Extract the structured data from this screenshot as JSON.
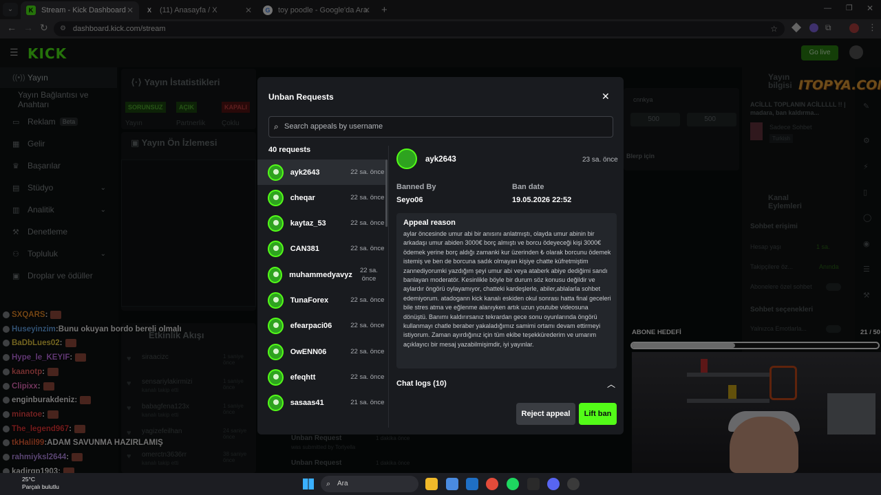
{
  "browser": {
    "tabs": [
      {
        "title": "Stream - Kick Dashboard",
        "icon": "kick-icon"
      },
      {
        "title": "(11) Anasayfa / X",
        "icon": "x-icon"
      },
      {
        "title": "toy poodle - Google'da Ara",
        "icon": "google-icon"
      }
    ],
    "new_tab": "+",
    "url": "dashboard.kick.com/stream"
  },
  "kick": {
    "logo": "KICK",
    "go_live": "Go live",
    "sidebar": [
      {
        "label": "Yayın",
        "icon": "broadcast-icon"
      },
      {
        "label": "Yayın Bağlantısı ve Anahtarı",
        "icon": ""
      },
      {
        "label": "Reklam",
        "icon": "ad-icon",
        "badge": "Beta"
      },
      {
        "label": "Gelir",
        "icon": "revenue-icon"
      },
      {
        "label": "Başarılar",
        "icon": "trophy-icon"
      },
      {
        "label": "Stüdyo",
        "icon": "studio-icon"
      },
      {
        "label": "Analitik",
        "icon": "analytics-icon"
      },
      {
        "label": "Denetleme",
        "icon": "moderation-icon"
      },
      {
        "label": "Topluluk",
        "icon": "community-icon"
      },
      {
        "label": "Droplar ve ödüller",
        "icon": "drops-icon"
      }
    ],
    "stats_title": "Yayın İstatistikleri",
    "stats_badges": [
      "SORUNSUZ",
      "AÇIK",
      "KAPALI"
    ],
    "stats_labels": [
      "Yayın",
      "Partnerlik",
      "Çoklu"
    ],
    "preview_title": "Yayın Ön İzlemesi",
    "activity_title": "Etkinlik Akışı",
    "activity_items": [
      {
        "user": "siraacizc",
        "sub": "kanalı takip etti",
        "time": "1 saniye önce"
      },
      {
        "user": "sensariylakirmizi",
        "sub": "kanalı takip etti",
        "time": "1 saniye önce"
      },
      {
        "user": "babagfena123x",
        "sub": "kanalı takip etti",
        "time": "1 saniye önce"
      },
      {
        "user": "yagizefeilhan",
        "sub": "kanalı takip etti",
        "time": "24 saniye önce"
      },
      {
        "user": "omerctn3636rr",
        "sub": "kanalı takip etti",
        "time": "38 saniye önce"
      }
    ],
    "unban_bottom": [
      {
        "title": "Unban Request",
        "sub": "was submitted by Torlyella",
        "time": "1 dakika önce"
      },
      {
        "title": "Unban Request",
        "sub": "",
        "time": "1 dakika önce"
      }
    ],
    "right_panel": {
      "stream_info_title": "Yayın bilgisi",
      "stream_title_text": "ACİLLL TOPLANIN ACİLLLLL !! | madara, ban kaldırma...",
      "category": "Sadece Sohbet",
      "language": "Turkish",
      "channel_actions_title": "Kanal Eylemleri",
      "chat_access": "Sohbet erişimi",
      "account_age": "Hesap yaşı",
      "account_age_value": "1 sa.",
      "followers_only": "Takipçilere öz...",
      "followers_value": "Anında",
      "subs_only": "Abonelere özel sohbet",
      "chat_options": "Sohbet seçenekleri",
      "emotes_only": "Yalnızca Emotlarla..."
    },
    "middle_right": {
      "user": "cnnkya",
      "pill_values": [
        "500",
        "500"
      ],
      "blerp": "Blerp için"
    }
  },
  "modal": {
    "title": "Unban Requests",
    "search_placeholder": "Search appeals by username",
    "count": "40 requests",
    "requests": [
      {
        "user": "ayk2643",
        "time": "22 sa. önce"
      },
      {
        "user": "cheqar",
        "time": "22 sa. önce"
      },
      {
        "user": "kaytaz_53",
        "time": "22 sa. önce"
      },
      {
        "user": "CAN381",
        "time": "22 sa. önce"
      },
      {
        "user": "muhammedyavyz",
        "time": "22 sa. önce"
      },
      {
        "user": "TunaForex",
        "time": "22 sa. önce"
      },
      {
        "user": "efearpaci06",
        "time": "22 sa. önce"
      },
      {
        "user": "OwENN06",
        "time": "22 sa. önce"
      },
      {
        "user": "efeqhtt",
        "time": "22 sa. önce"
      },
      {
        "user": "sasaas41",
        "time": "21 sa. önce"
      }
    ],
    "detail": {
      "user": "ayk2643",
      "time": "23 sa. önce",
      "banned_by_label": "Banned By",
      "banned_by": "Seyo06",
      "ban_date_label": "Ban date",
      "ban_date": "19.05.2026 22:52",
      "appeal_title": "Appeal reason",
      "appeal_text": "aylar öncesinde umur abi bir anısını anlatmıştı, olayda umur abinin bir arkadaşı umur abiden 3000€ borç almıştı ve borcu ödeyeceği kişi 3000€ ödemek yerine borç aldığı zamanki kur üzerinden ₺ olarak borcunu ödemek istemiş ve ben de borcuna sadık olmayan kişiye chatte küfretmiştim zannediyorumki yazdığım şeyi umur abi veya ataberk abiye dediğimi sandı banlayan moderatör. Kesinlikle böyle bir durum söz konusu değildir ve aylardır öngörü oylayamıyor, chatteki kardeşlerle, abiler,ablalarla sohbet edemiyorum. atadogann kick kanalı eskiden okul sonrası hatta final geceleri bile stres atma ve eğlenme alanıyken artık uzun youtube videosuna dönüştü. Banımı kaldırırsanız tekrardan gece sonu oyunlarında öngörü kullanmayı chatle beraber yakaladığımız samimi ortamı devam ettirmeyi istiyorum. Zaman ayırdığınız için tüm ekibe teşekkürederim ve umarım açıklayıcı bir mesaj yazabilmişimdir, iyi yayınlar.",
      "chat_logs": "Chat logs (10)",
      "reject_label": "Reject appeal",
      "lift_label": "Lift ban"
    }
  },
  "chat_overlay": [
    {
      "user": "SXQARS",
      "color": "#ff9a2e",
      "msg": ""
    },
    {
      "user": "Huseyinzim",
      "color": "#6fb7ff",
      "msg": "Bunu okuyan bordo bereli olmalı"
    },
    {
      "user": "BaDbLues02",
      "color": "#ffe14a",
      "msg": ""
    },
    {
      "user": "Hype_le_KEYIF",
      "color": "#d67cff",
      "msg": ""
    },
    {
      "user": "kaanotp",
      "color": "#ff6b6b",
      "msg": ""
    },
    {
      "user": "Clipixx",
      "color": "#ff7bd0",
      "msg": ""
    },
    {
      "user": "enginburakdeniz",
      "color": "#ffffff",
      "msg": ""
    },
    {
      "user": "minatoe",
      "color": "#ff4d4d",
      "msg": ""
    },
    {
      "user": "The_legend967",
      "color": "#ff3d3d",
      "msg": ""
    },
    {
      "user": "tkHalil99",
      "color": "#ff6a3d",
      "msg": "ADAM SAVUNMA HAZIRLAMIŞ"
    },
    {
      "user": "rahmiyksl2644",
      "color": "#c89bff",
      "msg": ""
    },
    {
      "user": "kadirgp1903",
      "color": "#ffffff",
      "msg": ""
    }
  ],
  "stream_overlay": {
    "watermark": "ITOPYA.COM",
    "sub_goal_label": "ABONE HEDEFİ",
    "sub_goal_count": "21 / 50",
    "sub_goal_progress": 0.42
  },
  "taskbar": {
    "weather_temp": "25°C",
    "weather_desc": "Parçalı bulutlu",
    "search_placeholder": "Ara"
  }
}
